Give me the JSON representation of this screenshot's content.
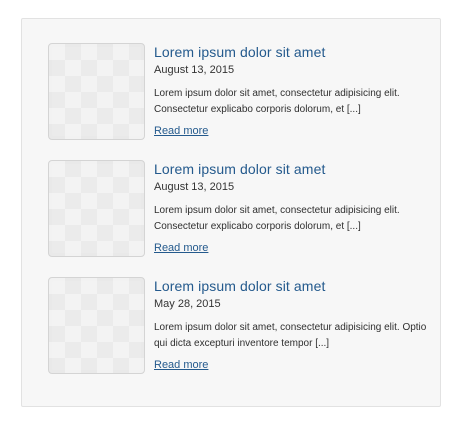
{
  "posts": [
    {
      "title": "Lorem ipsum dolor sit amet",
      "date": "August 13, 2015",
      "excerpt": "Lorem ipsum dolor sit amet, consectetur adipisicing elit. Consectetur explicabo corporis dolorum, et [...]",
      "read_more": "Read more"
    },
    {
      "title": "Lorem ipsum dolor sit amet",
      "date": "August 13, 2015",
      "excerpt": "Lorem ipsum dolor sit amet, consectetur adipisicing elit. Consectetur explicabo corporis dolorum, et [...]",
      "read_more": "Read more"
    },
    {
      "title": "Lorem ipsum dolor sit amet",
      "date": "May 28, 2015",
      "excerpt": "Lorem ipsum dolor sit amet, consectetur adipisicing elit. Optio qui dicta excepturi inventore tempor [...]",
      "read_more": "Read more"
    }
  ],
  "colors": {
    "link": "#245a8d",
    "panel_background": "#f7f7f7",
    "panel_border": "#e2e2e2"
  }
}
